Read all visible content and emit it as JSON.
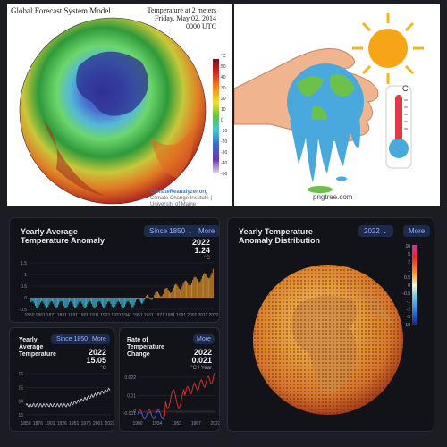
{
  "gfs": {
    "title": "Global Forecast System Model",
    "subtitle_line1": "Temperature at 2 meters",
    "subtitle_line2": "Friday, May 02, 2014",
    "subtitle_line3": "0000 UTC",
    "credit_brand": "ClimateReanalyzer.org",
    "credit_org": "Climate Change Institute | University of Maine",
    "scale_labels": [
      "°C",
      "50",
      "40",
      "30",
      "20",
      "10",
      "0",
      "-10",
      "-20",
      "-30",
      "-40",
      "-50"
    ]
  },
  "illustration": {
    "watermark": "pngtree.com"
  },
  "anomaly_panel": {
    "title_line1": "Yearly Average",
    "title_line2": "Temperature Anomaly",
    "dropdown": "Since 1850",
    "more": "More",
    "year": "2022",
    "value": "1.24",
    "unit": "°C",
    "chart_data": {
      "type": "bar",
      "x_ticks": [
        "1850",
        "1861",
        "1871",
        "1881",
        "1891",
        "1901",
        "1911",
        "1921",
        "1931",
        "1941",
        "1951",
        "1961",
        "1971",
        "1981",
        "1991",
        "2001",
        "2011",
        "2022"
      ],
      "y_ticks": [
        "1.5",
        "1",
        "0.5",
        "0",
        "-0.5"
      ],
      "ylim": [
        -0.5,
        1.5
      ],
      "first_year": 1850,
      "last_year": 2022,
      "last_value": 1.24
    }
  },
  "avg_panel": {
    "title_line1": "Yearly",
    "title_line2": "Average",
    "title_line3": "Temperature",
    "dropdown": "Since 1850",
    "more": "More",
    "year": "2022",
    "value": "15.05",
    "unit": "°C",
    "chart_data": {
      "type": "line",
      "x_ticks": [
        "1850",
        "1876",
        "1901",
        "1926",
        "1951",
        "1976",
        "2001",
        "2022"
      ],
      "y_ticks": [
        "16",
        "15",
        "14",
        "13"
      ],
      "ylim": [
        12.8,
        16.2
      ],
      "start_value": 13.7,
      "end_value": 15.05
    }
  },
  "rate_panel": {
    "title_line1": "Rate of",
    "title_line2": "Temperature",
    "title_line3": "Change",
    "more": "More",
    "year": "2022",
    "value": "0.021",
    "unit": "°C / Year",
    "chart_data": {
      "type": "line",
      "x_ticks": [
        "1900",
        "1934",
        "1953",
        "1967",
        "2022"
      ],
      "y_ticks": [
        "0.022",
        "0.01",
        "0",
        "-0.001"
      ],
      "ylim": [
        -0.004,
        0.026
      ]
    }
  },
  "dist_panel": {
    "title_line1": "Yearly Temperature",
    "title_line2": "Anomaly Distribution",
    "dropdown": "2022",
    "more": "More",
    "legend_labels": [
      "10",
      "5",
      "2",
      "1",
      "0.5",
      "0",
      "-0.5",
      "-1",
      "-2",
      "-5",
      "-10"
    ]
  }
}
